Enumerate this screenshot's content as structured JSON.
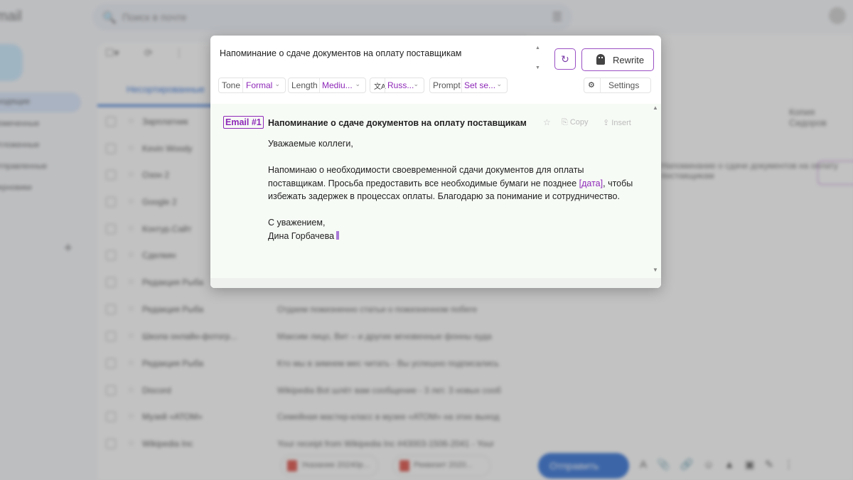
{
  "background": {
    "search_placeholder": "Поиск в почте",
    "logo": "mail",
    "nav_items": [
      "Входящие",
      "Помеченные",
      "Отложенные",
      "Отправленные",
      "Черновики"
    ],
    "tab_label": "Несортированные",
    "rows": [
      {
        "sender": "Зарплатник",
        "subject": ""
      },
      {
        "sender": "Kevin Woody",
        "subject": ""
      },
      {
        "sender": "Озон 2",
        "subject": ""
      },
      {
        "sender": "Google 2",
        "subject": ""
      },
      {
        "sender": "Контур.Сайт",
        "subject": ""
      },
      {
        "sender": "Сделкин",
        "subject": ""
      },
      {
        "sender": "Редакция Рыба",
        "subject": ""
      },
      {
        "sender": "Редакция Рыба",
        "subject": "Отдаем пожизненно статьи о пожизненном побеге"
      },
      {
        "sender": "Школа онлайн-фотогр...",
        "subject": "Максим лицо, Вит – и другие мгновенные фонны куда"
      },
      {
        "sender": "Редакция Рыба",
        "subject": "Кто мы в зимнем мес читать - Вы успешно подписались"
      },
      {
        "sender": "Discord",
        "subject": "Wikipedia Bot шлёт вам сообщение - 3 лет. 3 новых сооб"
      },
      {
        "sender": "Музей «АТОМ»",
        "subject": "Семейная мастер-класс в музее «АТОМ» на этих выход"
      },
      {
        "sender": "Wikipedia Inc",
        "subject": "Your receipt from Wikipedia Inc #43003-1506-2041 - Your"
      }
    ],
    "attachments": [
      "Указание 20240р...",
      "Реквизит 2020..."
    ],
    "send_label": "Отправить",
    "reading_title": "Копия Сидоров"
  },
  "dialog": {
    "subject": "Напоминание о сдаче документов на оплату поставщикам",
    "rewrite_label": "Rewrite",
    "options": {
      "tone": {
        "label": "Tone",
        "value": "Formal"
      },
      "length": {
        "label": "Length",
        "value": "Mediu..."
      },
      "language": {
        "value": "Russ..."
      },
      "prompt": {
        "label": "Prompt",
        "value": "Set se..."
      }
    },
    "settings_label": "Settings",
    "result": {
      "tag": "Email #1",
      "title": "Напоминание о сдаче документов на оплату поставщикам",
      "copy_label": "Copy",
      "insert_label": "Insert",
      "greeting": "Уважаемые коллеги,",
      "para_before": "Напоминаю о необходимости своевременной сдачи документов для оплаты поставщикам. Просьба предоставить все необходимые бумаги не позднее ",
      "placeholder": "[дата]",
      "para_after": ", чтобы избежать задержек в процессах оплаты. Благодарю за понимание и сотрудничество.",
      "closing": "С уважением,",
      "signature": "Дина Горбачева"
    }
  }
}
